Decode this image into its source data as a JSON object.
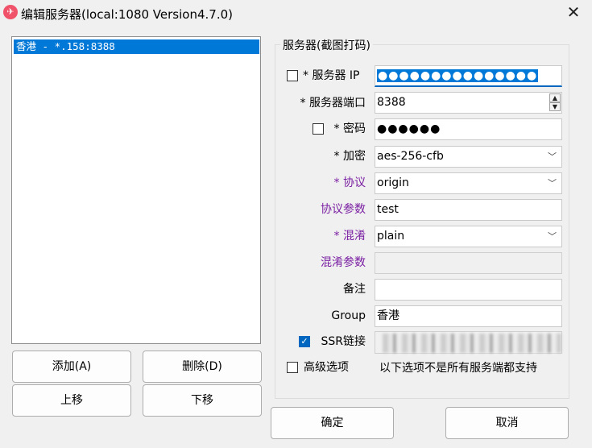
{
  "window": {
    "title": "编辑服务器(local:1080 Version4.7.0)",
    "close_glyph": "✕",
    "icon_glyph": "✈"
  },
  "server_list": {
    "items": [
      "香港 - *.158:8388"
    ]
  },
  "list_buttons": {
    "add": "添加(A)",
    "delete": "删除(D)",
    "move_up": "上移",
    "move_down": "下移"
  },
  "group_title": "服务器(截图打码)",
  "form": {
    "server_ip_label": "* 服务器 IP",
    "server_ip_value": "●●●●●●●●●●●●●●●",
    "port_label": "* 服务器端口",
    "port_value": "8388",
    "password_label": "* 密码",
    "password_value": "●●●●●●",
    "encryption_label": "* 加密",
    "encryption_value": "aes-256-cfb",
    "protocol_label": "* 协议",
    "protocol_value": "origin",
    "protocol_param_label": "协议参数",
    "protocol_param_value": "test",
    "obfs_label": "* 混淆",
    "obfs_value": "plain",
    "obfs_param_label": "混淆参数",
    "obfs_param_value": "",
    "remarks_label": "备注",
    "remarks_value": "",
    "group_label": "Group",
    "group_value": "香港",
    "ssr_link_label": "SSR链接",
    "advanced_label": "高级选项",
    "advanced_note": "以下选项不是所有服务端都支持"
  },
  "checkboxes": {
    "show_ip": false,
    "show_password": false,
    "ssr_link": true,
    "advanced": false
  },
  "dialog_buttons": {
    "ok": "确定",
    "cancel": "取消"
  },
  "colors": {
    "accent": "#0078d7",
    "required_purple": "#7a1fa2"
  }
}
